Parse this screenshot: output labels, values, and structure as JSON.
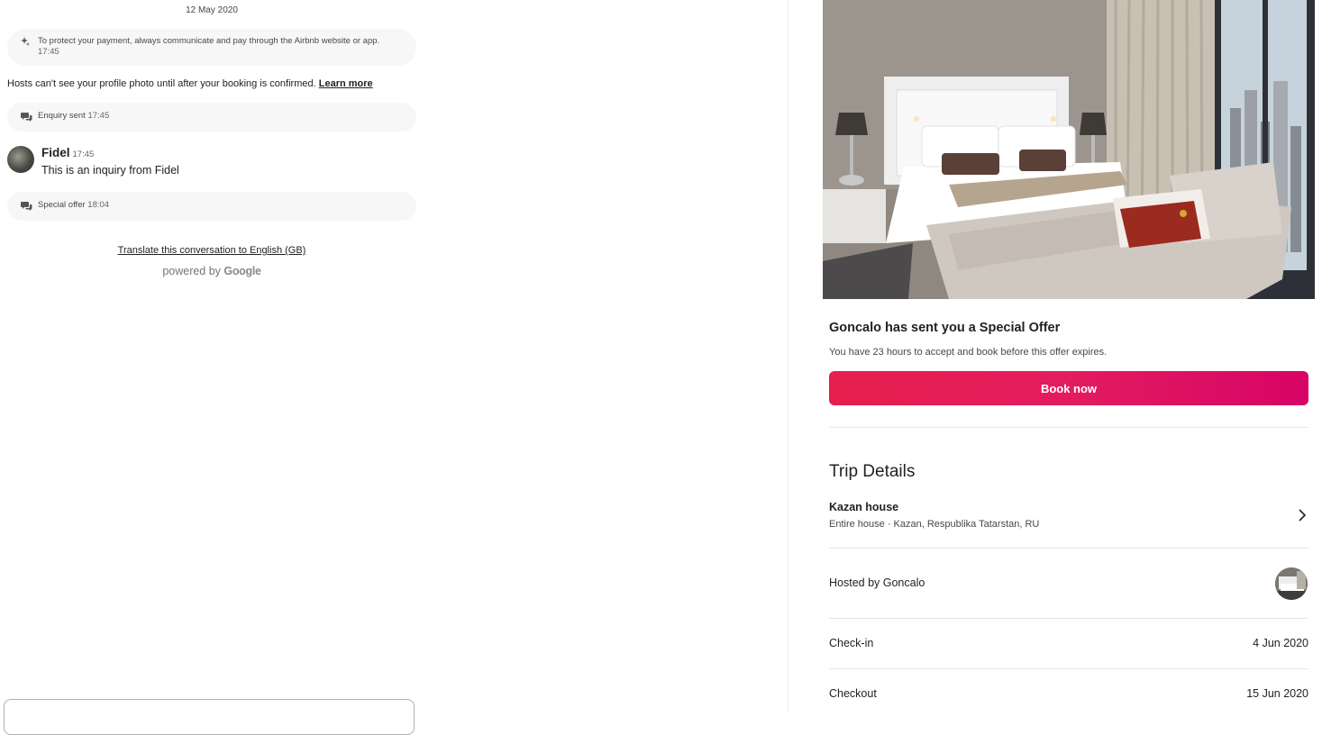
{
  "conversation": {
    "date": "12 May 2020",
    "security_notice": {
      "text": "To protect your payment, always communicate and pay through the Airbnb website or app.",
      "time": "17:45"
    },
    "profile_note": {
      "text": "Hosts can't see your profile photo until after your booking is confirmed.",
      "link": "Learn more"
    },
    "enquiry_event": {
      "label": "Enquiry sent",
      "time": "17:45"
    },
    "message": {
      "sender": "Fidel",
      "time": "17:45",
      "body": "This is an inquiry from Fidel"
    },
    "offer_event": {
      "label": "Special offer",
      "time": "18:04"
    },
    "translate_link": "Translate this conversation to English (GB)",
    "powered_by": "powered by",
    "powered_brand": "Google"
  },
  "offer": {
    "title": "Goncalo has sent you a Special Offer",
    "subtitle": "You have 23 hours to accept and book before this offer expires.",
    "book_button": "Book now"
  },
  "trip": {
    "heading": "Trip Details",
    "listing_name": "Kazan house",
    "listing_sub": "Entire house · Kazan, Respublika Tatarstan, RU",
    "hosted_by": "Hosted by Goncalo",
    "checkin_label": "Check-in",
    "checkin_value": "4 Jun 2020",
    "checkout_label": "Checkout",
    "checkout_value": "15 Jun 2020"
  },
  "colors": {
    "accent": "#e31c5f",
    "divider": "#ebebeb",
    "pill_bg": "#f7f7f7"
  },
  "icons": [
    "sparkle-icon",
    "chat-bubbles-icon",
    "chevron-right-icon"
  ]
}
